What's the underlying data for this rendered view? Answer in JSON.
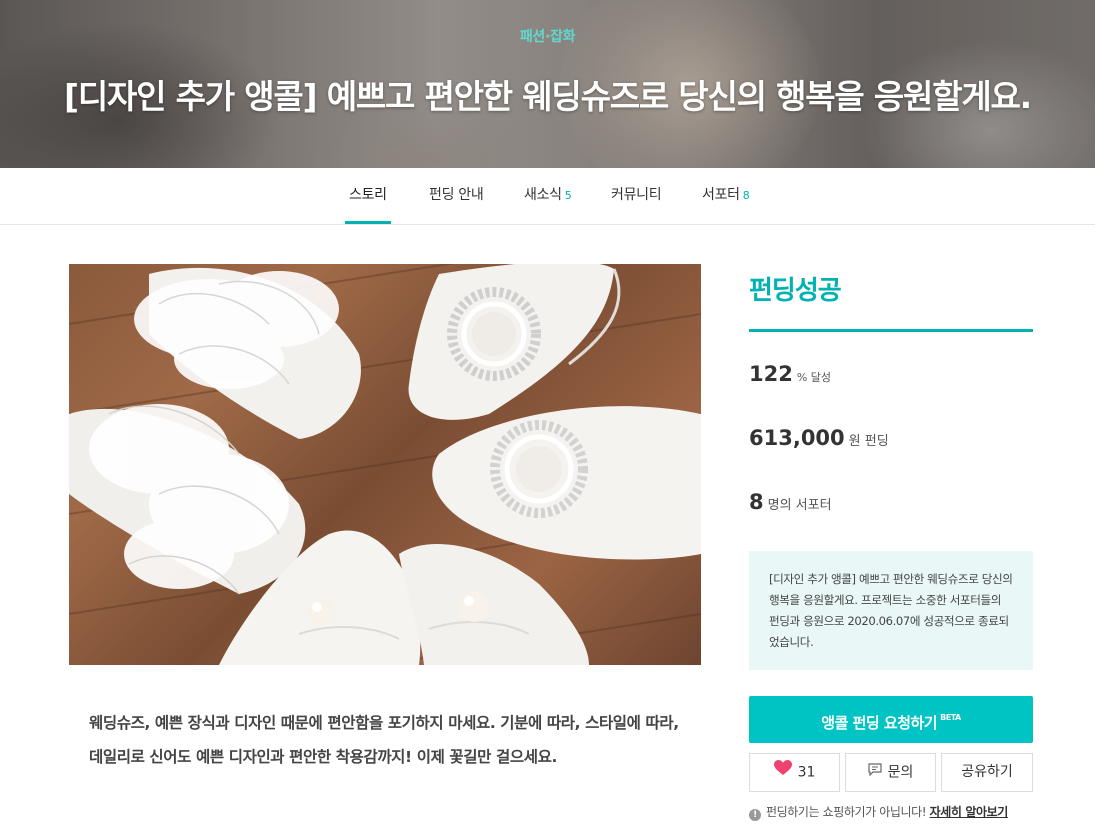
{
  "hero": {
    "category": "패션·잡화",
    "title": "[디자인 추가 앵콜] 예쁘고 편안한 웨딩슈즈로 당신의 행복을 응원할게요."
  },
  "tabs": [
    {
      "label": "스토리",
      "count": ""
    },
    {
      "label": "펀딩 안내",
      "count": ""
    },
    {
      "label": "새소식",
      "count": "5"
    },
    {
      "label": "커뮤니티",
      "count": ""
    },
    {
      "label": "서포터",
      "count": "8"
    }
  ],
  "active_tab": "스토리",
  "story": {
    "description": "웨딩슈즈, 예쁜 장식과 디자인 때문에 편안함을 포기하지 마세요. 기분에 따라, 스타일에 따라, 데일리로 신어도 예쁜 디자인과 편안한 착용감까지! 이제 꽃길만 걸으세요."
  },
  "sidebar": {
    "status": "펀딩성공",
    "achievement": {
      "value": "122",
      "unit": "% 달성"
    },
    "amount": {
      "value": "613,000",
      "unit": "원 펀딩"
    },
    "supporters": {
      "value": "8",
      "unit": "명의 서포터"
    },
    "notice": "[디자인 추가 앵콜] 예쁘고 편안한 웨딩슈즈로 당신의 행복을 응원할게요. 프로젝트는 소중한 서포터들의 펀딩과 응원으로 2020.06.07에 성공적으로 종료되었습니다.",
    "encore_button": "앵콜 펀딩 요청하기",
    "encore_badge": "BETA",
    "like_count": "31",
    "inquiry_label": "문의",
    "share_label": "공유하기",
    "footnote_text": "펀딩하기는 쇼핑하기가 아닙니다!",
    "footnote_link": "자세히 알아보기"
  },
  "colors": {
    "accent": "#00b2b2",
    "button": "#00c4c4",
    "notice_bg": "#e9f8f6",
    "heart": "#f0426e"
  }
}
